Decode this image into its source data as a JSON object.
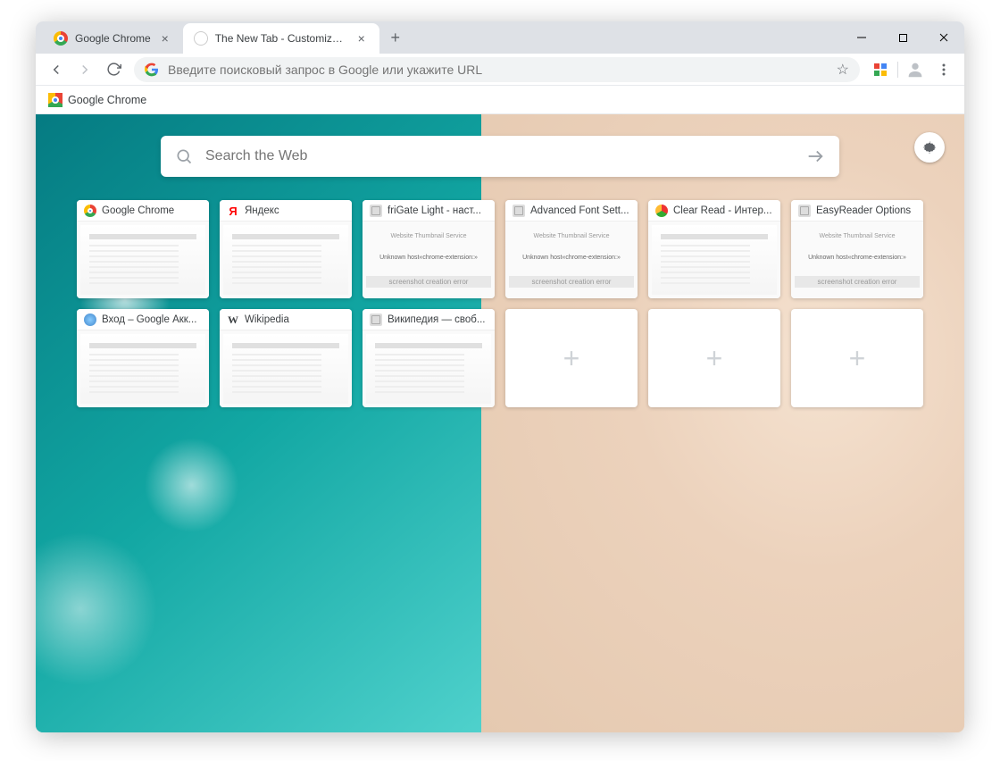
{
  "tabs": {
    "t0": {
      "title": "Google Chrome"
    },
    "t1": {
      "title": "The New Tab - Customize Your Start P"
    }
  },
  "omnibox": {
    "placeholder": "Введите поисковый запрос в Google или укажите URL"
  },
  "bookmarks": {
    "b0": "Google Chrome"
  },
  "search": {
    "placeholder": "Search the Web"
  },
  "tiles": {
    "t0": "Google Chrome",
    "t1": "Яндекс",
    "t2": "friGate Light - наст...",
    "t3": "Advanced Font Sett...",
    "t4": "Clear Read - Интер...",
    "t5": "EasyReader Options",
    "t6": "Вход – Google Акк...",
    "t7": "Wikipedia",
    "t8": "Википедия — своб..."
  },
  "thumb_err": {
    "line1": "Website Thumbnail Service",
    "line2": "Unknown host«chrome-extension:»",
    "line3": "screenshot creation error"
  }
}
